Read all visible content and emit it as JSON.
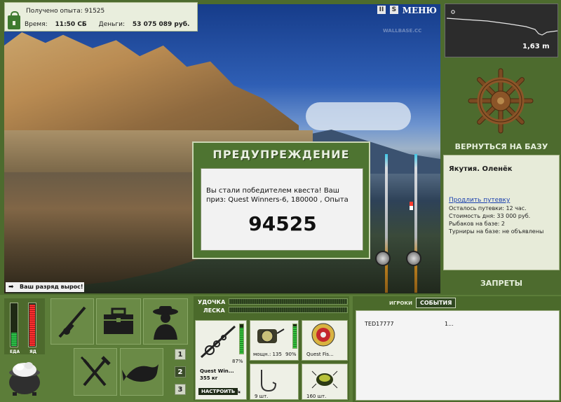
{
  "info": {
    "exp_label": "Получено опыта:",
    "exp_value": "91525",
    "time_label": "Время:",
    "time_value": "11:50 СБ",
    "money_label": "Деньги:",
    "money_value": "53 075 089 руб."
  },
  "top_menu": {
    "pause": "II",
    "sound": "S",
    "menu_label": "МЕНЮ"
  },
  "scene": {
    "watermark": "WALLBASE.CC"
  },
  "warning": {
    "title": "ПРЕДУПРЕЖДЕНИЕ",
    "message": "Вы стали победителем квеста! Ваш приз: Quest Winners-6, 180000 , Опыта",
    "points": "94525"
  },
  "rank_notice": "Ваш разряд вырос!",
  "sonar": {
    "depth": "1,63 m"
  },
  "right": {
    "back_to_base": "ВЕРНУТЬСЯ НА БАЗУ",
    "location": "Якутия. Оленёк",
    "extend_link": "Продлить путевку",
    "lines": [
      "Осталось путевки: 12 час.",
      "Стоимость дня: 33 000 руб.",
      "Рыбаков на базе: 2",
      "Турниры на базе: не объявлены"
    ],
    "bans": "ЗАПРЕТЫ"
  },
  "meters": {
    "food_label": "ЕДА",
    "poison_label": "ЯД",
    "food_level": 0.3,
    "poison_level": 0.95
  },
  "slots": {
    "tabs": [
      "1",
      "2",
      "3"
    ],
    "active_tab": 1
  },
  "gear": {
    "rod_label": "УДОЧКА",
    "line_label": "ЛЕСКА",
    "rod_name": "Quest Win...",
    "rod_weight": "355 кг",
    "rod_percent": "87%",
    "reel_power": "мощн.: 135",
    "reel_percent": "90%",
    "line_name": "Quest Fis...",
    "hooks_count": "9 шт.",
    "bait_count": "160 шт.",
    "setup_label": "НАСТРОИТЬ"
  },
  "players": {
    "tab_players": "ИГРОКИ",
    "tab_events": "СОБЫТИЯ",
    "list": [
      {
        "name": "TED17777",
        "value": "1..."
      }
    ]
  }
}
